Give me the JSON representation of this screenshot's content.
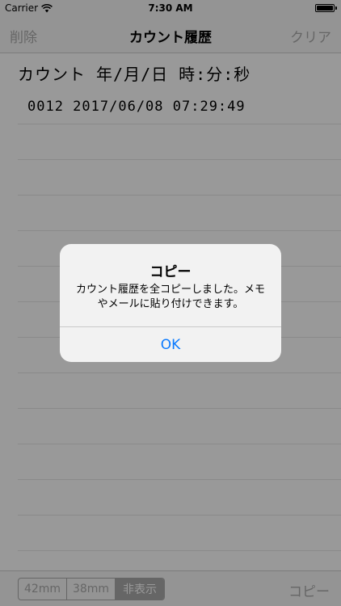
{
  "status_bar": {
    "carrier": "Carrier",
    "time": "7:30 AM",
    "wifi_icon": "wifi-icon",
    "battery_icon": "battery-icon",
    "battery_level": 1.0
  },
  "nav": {
    "left_label": "削除",
    "title": "カウント履歴",
    "right_label": "クリア"
  },
  "list": {
    "header": "カウント 年/月/日 時:分:秒",
    "entries": [
      "0012 2017/06/08 07:29:49"
    ]
  },
  "toolbar": {
    "segments": [
      "42mm",
      "38mm",
      "非表示"
    ],
    "selected_segment": "非表示",
    "copy_label": "コピー"
  },
  "alert": {
    "title": "コピー",
    "message": "カウント履歴を全コピーしました。メモやメールに貼り付けできます。",
    "ok_label": "OK"
  },
  "colors": {
    "accent": "#0a7aff",
    "disabled": "#aaaaaa"
  }
}
